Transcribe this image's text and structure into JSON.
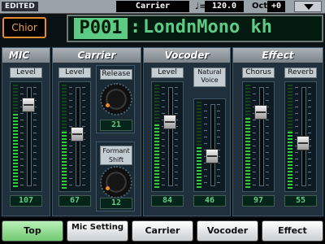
{
  "status": {
    "edited": "EDITED",
    "source": "Carrier",
    "tempo_icon": "♩=",
    "tempo": "120.0",
    "octave_label": "Oct",
    "octave": "+0",
    "menu_icon": "triangle-down-icon"
  },
  "program": {
    "category": "Chior",
    "number": "P001",
    "colon": ":",
    "name": "LondnMono kh"
  },
  "sections": {
    "mic": "MIC",
    "carrier": "Carrier",
    "vocoder": "Vocoder",
    "effect": "Effect"
  },
  "faders": {
    "mic_level": {
      "label": "Level",
      "value": "107",
      "position": 0.84,
      "meter": 0.72
    },
    "carrier_level": {
      "label": "Level",
      "value": "67",
      "position": 0.53,
      "meter": 0.55
    },
    "vocoder_level": {
      "label": "Level",
      "value": "84",
      "position": 0.66,
      "meter": 0.62
    },
    "natural_voice": {
      "label": "Natural Voice",
      "value": "46",
      "position": 0.36,
      "meter": 0.48
    },
    "chorus": {
      "label": "Chorus",
      "value": "97",
      "position": 0.76,
      "meter": 0.68
    },
    "reverb": {
      "label": "Reverb",
      "value": "55",
      "position": 0.43,
      "meter": 0.55
    }
  },
  "knobs": {
    "release": {
      "label": "Release",
      "value": "21"
    },
    "formant_shift": {
      "label": "Formant Shift",
      "value": "12"
    }
  },
  "tabs": [
    "Top",
    "Mic Setting",
    "Carrier",
    "Vocoder",
    "Effect"
  ],
  "colors": {
    "accent_green": "#5ecb84",
    "meter_green": "#2fcf3a",
    "category_orange": "#e68a2e"
  }
}
